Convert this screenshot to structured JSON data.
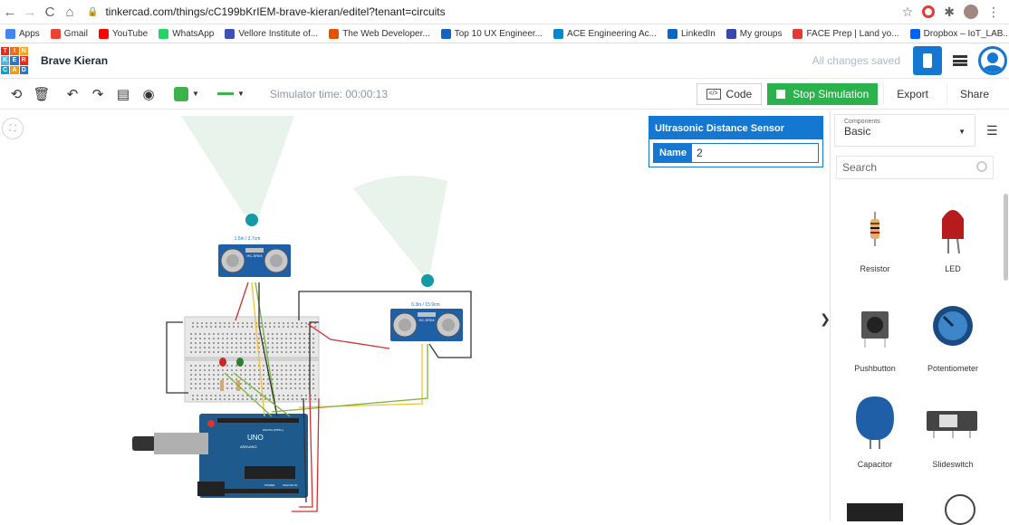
{
  "browser": {
    "url": "tinkercad.com/things/cC199bKrIEM-brave-kieran/editel?tenant=circuits",
    "bookmarks": [
      {
        "label": "Apps",
        "color": "#4285f4"
      },
      {
        "label": "Gmail",
        "color": "#ea4335"
      },
      {
        "label": "YouTube",
        "color": "#ff0000"
      },
      {
        "label": "WhatsApp",
        "color": "#25d366"
      },
      {
        "label": "Vellore Institute of...",
        "color": "#3f51b5"
      },
      {
        "label": "The Web Developer...",
        "color": "#e65100"
      },
      {
        "label": "Top 10 UX Engineer...",
        "color": "#1565c0"
      },
      {
        "label": "ACE Engineering Ac...",
        "color": "#0288d1"
      },
      {
        "label": "LinkedIn",
        "color": "#0a66c2"
      },
      {
        "label": "My groups",
        "color": "#3949ab"
      },
      {
        "label": "FACE Prep | Land yo...",
        "color": "#e53935"
      },
      {
        "label": "Dropbox – IoT_LAB...",
        "color": "#0061fe"
      }
    ],
    "more": "»"
  },
  "header": {
    "logo_letters": [
      "T",
      "I",
      "N",
      "K",
      "E",
      "R",
      "C",
      "A",
      "D"
    ],
    "logo_colors": [
      "#e52b20",
      "#ed6d1d",
      "#f7a528",
      "#49b8e6",
      "#2a76c6",
      "#e52b20",
      "#00a6d6",
      "#f39c12",
      "#2a76c6"
    ],
    "project_name": "Brave Kieran",
    "save_status": "All changes saved"
  },
  "toolbar": {
    "sim_time": "Simulator time: 00:00:13",
    "code_label": "Code",
    "code_icon": "</>",
    "stop_label": "Stop Simulation",
    "export_label": "Export",
    "share_label": "Share",
    "wire_color": "#3cb44b"
  },
  "inspector": {
    "title": "Ultrasonic Distance Sensor",
    "name_label": "Name",
    "name_value": "2"
  },
  "circuit": {
    "sensor1_reading": "1.5in / 3.7cm",
    "sensor2_reading": "6.3in / 15.9cm",
    "sensor_model": "HC-SR04",
    "arduino_label": "UNO",
    "arduino_brand": "ARDUINO",
    "arduino_digital": "DIGITAL (PWM~)",
    "arduino_power": "POWER",
    "arduino_analog": "ANALOG IN"
  },
  "panel": {
    "components_label": "Components",
    "components_value": "Basic",
    "search_placeholder": "Search",
    "components": [
      "Resistor",
      "LED",
      "Pushbutton",
      "Potentiometer",
      "Capacitor",
      "Slideswitch"
    ]
  }
}
